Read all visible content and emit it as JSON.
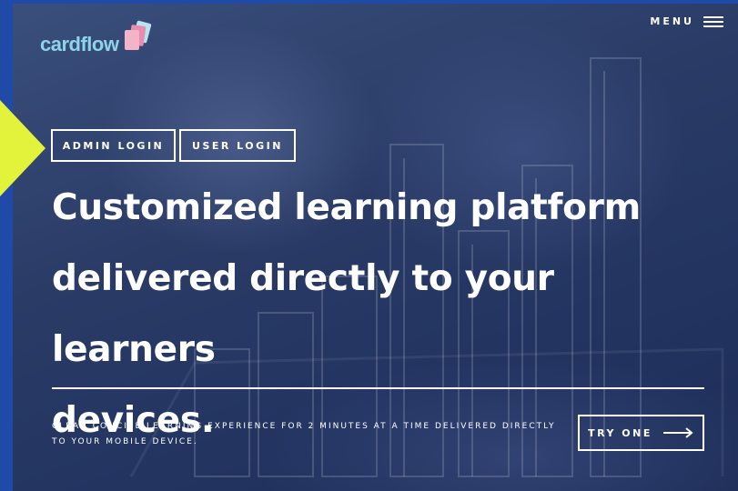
{
  "brand": {
    "logo_text": "cardflow",
    "logo_color": "#8fd3ea",
    "card_colors": [
      "#f3b3c9",
      "#e88db0",
      "#b9e3ef"
    ]
  },
  "nav": {
    "menu_label": "MENU",
    "menu_icon": "hamburger-icon"
  },
  "auth": {
    "admin_login_label": "ADMIN LOGIN",
    "user_login_label": "USER LOGIN"
  },
  "hero": {
    "headline_line1": "Customized learning platform",
    "headline_line2": "delivered directly to your learners",
    "headline_line3": "devices.",
    "tagline_line1": "CLEAN CONCISE LEARNING EXPERIENCE FOR 2 MINUTES AT A TIME DELIVERED DIRECTLY",
    "tagline_line2": "TO YOUR MOBILE DEVICE.",
    "cta_label": "TRY ONE",
    "cta_icon": "arrow-right-icon"
  },
  "colors": {
    "page_frame": "#1f4aa8",
    "accent_triangle": "#e3f23a",
    "overlay": "#26375f",
    "text": "#ffffff"
  }
}
